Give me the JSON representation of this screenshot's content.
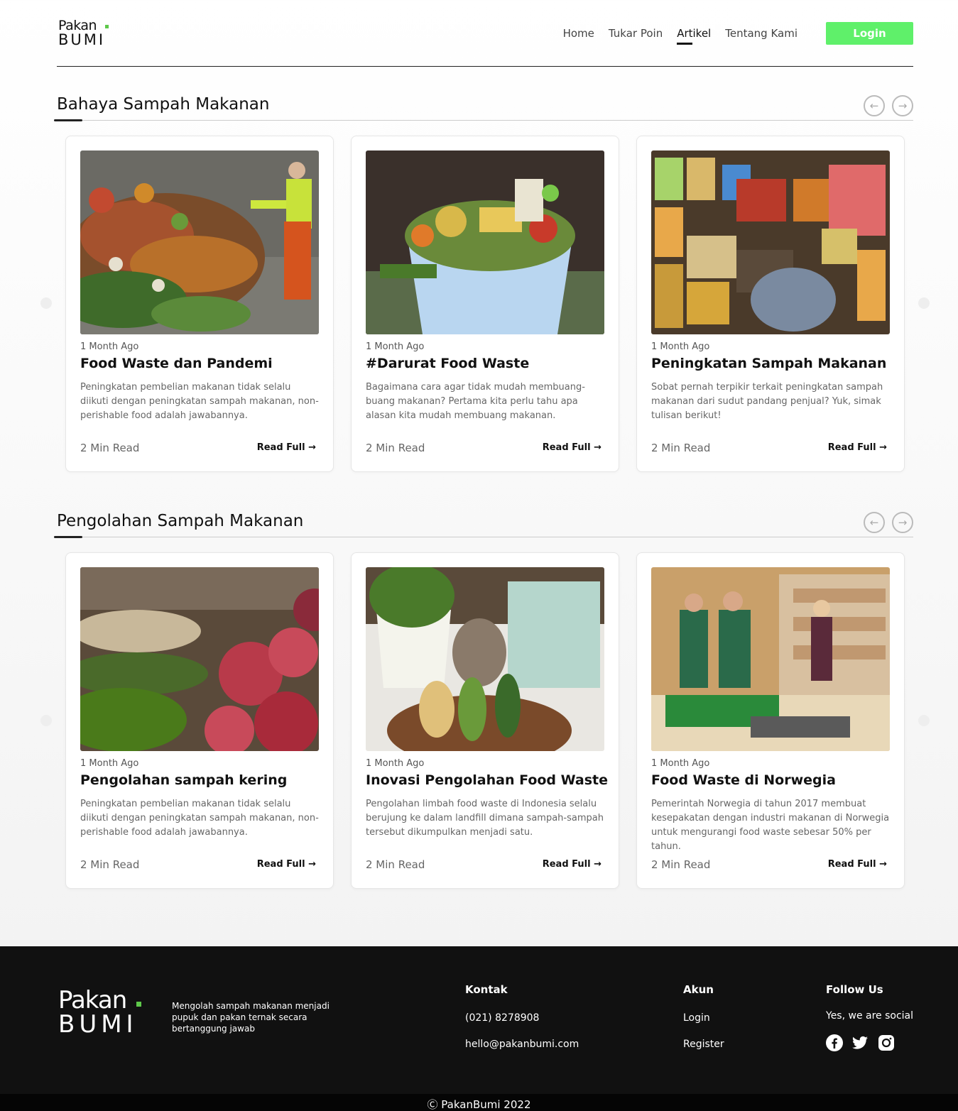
{
  "brand": {
    "line1": "Pakan",
    "line2": "BUMI",
    "accent": "#5ec84a"
  },
  "nav": {
    "items": [
      "Home",
      "Tukar Poin",
      "Artikel",
      "Tentang Kami"
    ],
    "active": "Artikel",
    "login_label": "Login",
    "login_color": "#5ff06a"
  },
  "sections": [
    {
      "title": "Bahaya Sampah Makanan",
      "cards": [
        {
          "meta": "1 Month Ago",
          "title": "Food Waste dan Pandemi",
          "desc": "Peningkatan pembelian makanan tidak selalu diikuti dengan peningkatan sampah makanan, non-perishable food adalah jawabannya.",
          "mins": "2 Min Read",
          "read": "Read Full"
        },
        {
          "meta": "1 Month Ago",
          "title": "#Darurat Food Waste",
          "desc": "Bagaimana cara agar tidak mudah membuang-buang makanan? Pertama kita perlu tahu apa alasan kita mudah membuang makanan.",
          "mins": "2 Min Read",
          "read": "Read Full"
        },
        {
          "meta": "1 Month Ago",
          "title": "Peningkatan Sampah Makanan",
          "desc": "Sobat pernah terpikir terkait peningkatan sampah makanan dari sudut pandang penjual? Yuk, simak tulisan berikut!",
          "mins": "2 Min Read",
          "read": "Read Full"
        }
      ]
    },
    {
      "title": "Pengolahan Sampah Makanan",
      "cards": [
        {
          "meta": "1 Month Ago",
          "title": "Pengolahan sampah kering",
          "desc": "Peningkatan pembelian makanan tidak selalu diikuti dengan peningkatan sampah makanan, non-perishable food adalah jawabannya.",
          "mins": "2 Min Read",
          "read": "Read Full"
        },
        {
          "meta": "1 Month Ago",
          "title": "Inovasi Pengolahan Food Waste",
          "desc": "Pengolahan limbah food waste di Indonesia selalu berujung ke dalam landfill dimana sampah-sampah tersebut dikumpulkan menjadi satu.",
          "mins": "2 Min Read",
          "read": "Read Full"
        },
        {
          "meta": "1 Month Ago",
          "title": "Food Waste di Norwegia",
          "desc": "Pemerintah Norwegia di tahun 2017 membuat kesepakatan dengan industri makanan di Norwegia untuk mengurangi food waste sebesar 50% per tahun.",
          "mins": "2 Min Read",
          "read": "Read Full"
        }
      ]
    }
  ],
  "footer": {
    "tagline": "Mengolah sampah makanan menjadi pupuk dan pakan ternak secara bertanggung jawab",
    "kontak": {
      "heading": "Kontak",
      "phone": "(021) 8278908",
      "email": "hello@pakanbumi.com"
    },
    "akun": {
      "heading": "Akun",
      "login": "Login",
      "register": "Register"
    },
    "follow": {
      "heading": "Follow Us",
      "sub": "Yes, we are social",
      "icons": [
        "facebook-icon",
        "twitter-icon",
        "instagram-icon"
      ]
    },
    "copyright": "PakanBumi 2022"
  }
}
